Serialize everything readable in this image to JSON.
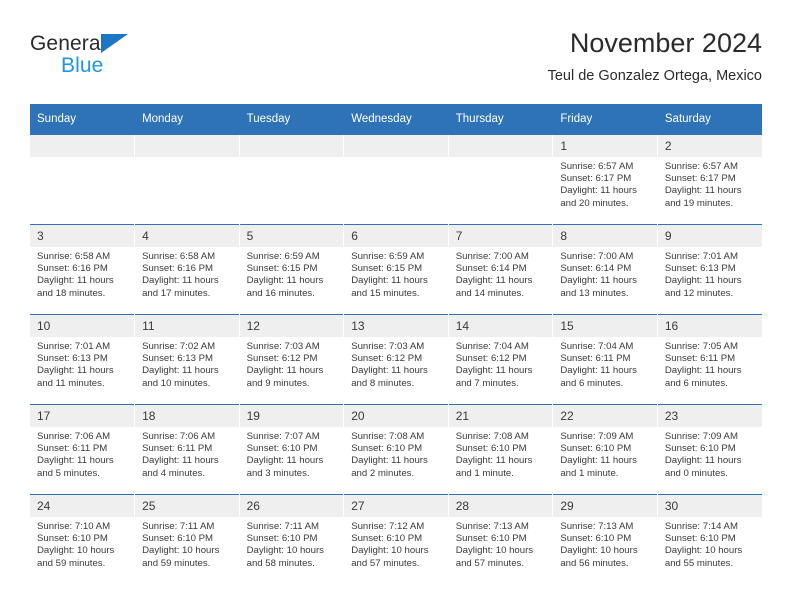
{
  "brand": {
    "name_top": "General",
    "name_bottom": "Blue",
    "color_dark": "#2b2b2b",
    "color_blue": "#2196e8",
    "triangle_color": "#1b76c6"
  },
  "header": {
    "title": "November 2024",
    "subtitle": "Teul de Gonzalez Ortega, Mexico",
    "accent_color": "#2e72b8",
    "daynum_band_color": "#efefef"
  },
  "weekday_headers": [
    "Sunday",
    "Monday",
    "Tuesday",
    "Wednesday",
    "Thursday",
    "Friday",
    "Saturday"
  ],
  "weeks": [
    [
      {
        "day": "",
        "lines": []
      },
      {
        "day": "",
        "lines": []
      },
      {
        "day": "",
        "lines": []
      },
      {
        "day": "",
        "lines": []
      },
      {
        "day": "",
        "lines": []
      },
      {
        "day": "1",
        "lines": [
          "Sunrise: 6:57 AM",
          "Sunset: 6:17 PM",
          "Daylight: 11 hours",
          "and 20 minutes."
        ]
      },
      {
        "day": "2",
        "lines": [
          "Sunrise: 6:57 AM",
          "Sunset: 6:17 PM",
          "Daylight: 11 hours",
          "and 19 minutes."
        ]
      }
    ],
    [
      {
        "day": "3",
        "lines": [
          "Sunrise: 6:58 AM",
          "Sunset: 6:16 PM",
          "Daylight: 11 hours",
          "and 18 minutes."
        ]
      },
      {
        "day": "4",
        "lines": [
          "Sunrise: 6:58 AM",
          "Sunset: 6:16 PM",
          "Daylight: 11 hours",
          "and 17 minutes."
        ]
      },
      {
        "day": "5",
        "lines": [
          "Sunrise: 6:59 AM",
          "Sunset: 6:15 PM",
          "Daylight: 11 hours",
          "and 16 minutes."
        ]
      },
      {
        "day": "6",
        "lines": [
          "Sunrise: 6:59 AM",
          "Sunset: 6:15 PM",
          "Daylight: 11 hours",
          "and 15 minutes."
        ]
      },
      {
        "day": "7",
        "lines": [
          "Sunrise: 7:00 AM",
          "Sunset: 6:14 PM",
          "Daylight: 11 hours",
          "and 14 minutes."
        ]
      },
      {
        "day": "8",
        "lines": [
          "Sunrise: 7:00 AM",
          "Sunset: 6:14 PM",
          "Daylight: 11 hours",
          "and 13 minutes."
        ]
      },
      {
        "day": "9",
        "lines": [
          "Sunrise: 7:01 AM",
          "Sunset: 6:13 PM",
          "Daylight: 11 hours",
          "and 12 minutes."
        ]
      }
    ],
    [
      {
        "day": "10",
        "lines": [
          "Sunrise: 7:01 AM",
          "Sunset: 6:13 PM",
          "Daylight: 11 hours",
          "and 11 minutes."
        ]
      },
      {
        "day": "11",
        "lines": [
          "Sunrise: 7:02 AM",
          "Sunset: 6:13 PM",
          "Daylight: 11 hours",
          "and 10 minutes."
        ]
      },
      {
        "day": "12",
        "lines": [
          "Sunrise: 7:03 AM",
          "Sunset: 6:12 PM",
          "Daylight: 11 hours",
          "and 9 minutes."
        ]
      },
      {
        "day": "13",
        "lines": [
          "Sunrise: 7:03 AM",
          "Sunset: 6:12 PM",
          "Daylight: 11 hours",
          "and 8 minutes."
        ]
      },
      {
        "day": "14",
        "lines": [
          "Sunrise: 7:04 AM",
          "Sunset: 6:12 PM",
          "Daylight: 11 hours",
          "and 7 minutes."
        ]
      },
      {
        "day": "15",
        "lines": [
          "Sunrise: 7:04 AM",
          "Sunset: 6:11 PM",
          "Daylight: 11 hours",
          "and 6 minutes."
        ]
      },
      {
        "day": "16",
        "lines": [
          "Sunrise: 7:05 AM",
          "Sunset: 6:11 PM",
          "Daylight: 11 hours",
          "and 6 minutes."
        ]
      }
    ],
    [
      {
        "day": "17",
        "lines": [
          "Sunrise: 7:06 AM",
          "Sunset: 6:11 PM",
          "Daylight: 11 hours",
          "and 5 minutes."
        ]
      },
      {
        "day": "18",
        "lines": [
          "Sunrise: 7:06 AM",
          "Sunset: 6:11 PM",
          "Daylight: 11 hours",
          "and 4 minutes."
        ]
      },
      {
        "day": "19",
        "lines": [
          "Sunrise: 7:07 AM",
          "Sunset: 6:10 PM",
          "Daylight: 11 hours",
          "and 3 minutes."
        ]
      },
      {
        "day": "20",
        "lines": [
          "Sunrise: 7:08 AM",
          "Sunset: 6:10 PM",
          "Daylight: 11 hours",
          "and 2 minutes."
        ]
      },
      {
        "day": "21",
        "lines": [
          "Sunrise: 7:08 AM",
          "Sunset: 6:10 PM",
          "Daylight: 11 hours",
          "and 1 minute."
        ]
      },
      {
        "day": "22",
        "lines": [
          "Sunrise: 7:09 AM",
          "Sunset: 6:10 PM",
          "Daylight: 11 hours",
          "and 1 minute."
        ]
      },
      {
        "day": "23",
        "lines": [
          "Sunrise: 7:09 AM",
          "Sunset: 6:10 PM",
          "Daylight: 11 hours",
          "and 0 minutes."
        ]
      }
    ],
    [
      {
        "day": "24",
        "lines": [
          "Sunrise: 7:10 AM",
          "Sunset: 6:10 PM",
          "Daylight: 10 hours",
          "and 59 minutes."
        ]
      },
      {
        "day": "25",
        "lines": [
          "Sunrise: 7:11 AM",
          "Sunset: 6:10 PM",
          "Daylight: 10 hours",
          "and 59 minutes."
        ]
      },
      {
        "day": "26",
        "lines": [
          "Sunrise: 7:11 AM",
          "Sunset: 6:10 PM",
          "Daylight: 10 hours",
          "and 58 minutes."
        ]
      },
      {
        "day": "27",
        "lines": [
          "Sunrise: 7:12 AM",
          "Sunset: 6:10 PM",
          "Daylight: 10 hours",
          "and 57 minutes."
        ]
      },
      {
        "day": "28",
        "lines": [
          "Sunrise: 7:13 AM",
          "Sunset: 6:10 PM",
          "Daylight: 10 hours",
          "and 57 minutes."
        ]
      },
      {
        "day": "29",
        "lines": [
          "Sunrise: 7:13 AM",
          "Sunset: 6:10 PM",
          "Daylight: 10 hours",
          "and 56 minutes."
        ]
      },
      {
        "day": "30",
        "lines": [
          "Sunrise: 7:14 AM",
          "Sunset: 6:10 PM",
          "Daylight: 10 hours",
          "and 55 minutes."
        ]
      }
    ]
  ]
}
